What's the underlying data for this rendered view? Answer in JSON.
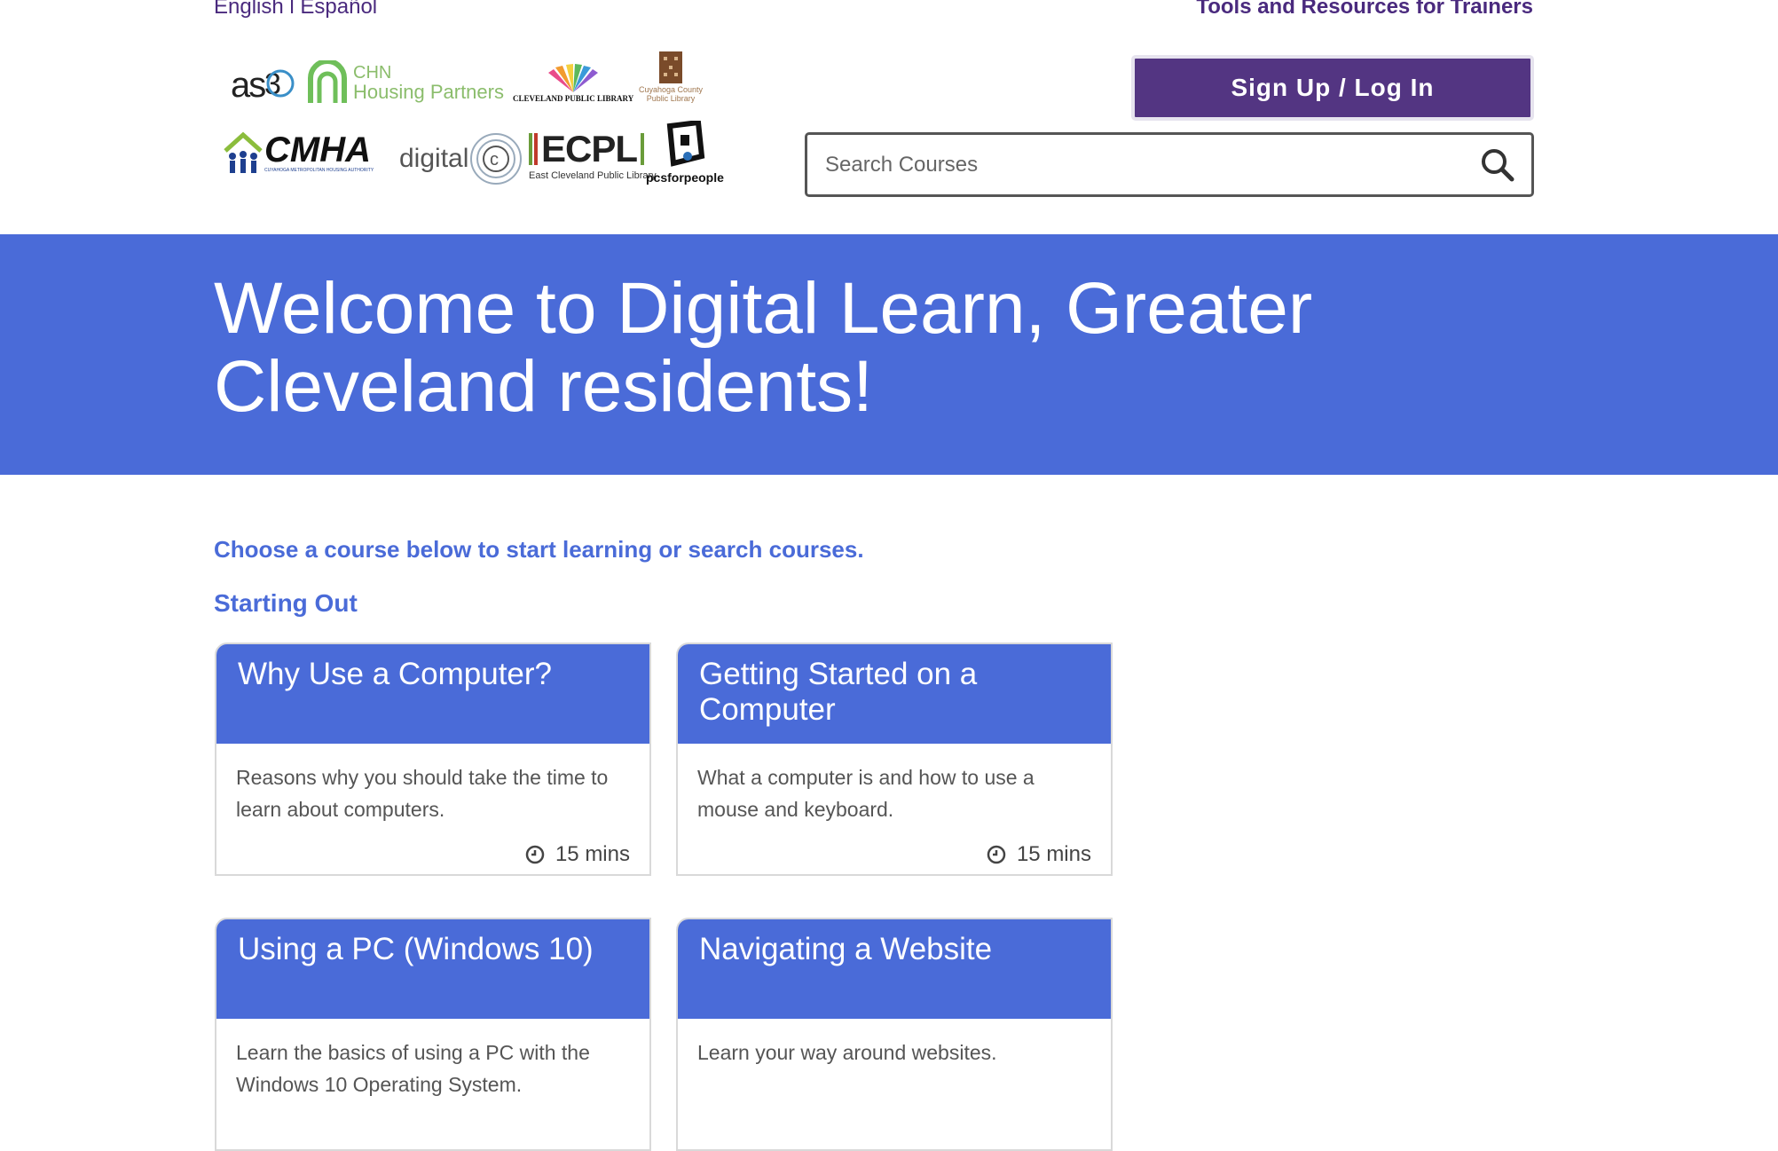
{
  "header": {
    "lang_english": "English",
    "lang_separator": " l ",
    "lang_espanol": "Español",
    "trainers_link": "Tools and Resources for Trainers",
    "signup_button": "Sign Up / Log In",
    "search_placeholder": "Search Courses"
  },
  "logos": {
    "aseb": "as",
    "chn_top": "CHN",
    "chn_bottom": "Housing Partners",
    "cleveland_public_library": "CLEVELAND PUBLIC LIBRARY",
    "cuyahoga_library_1": "Cuyahoga County",
    "cuyahoga_library_2": "Public Library",
    "cmha": "CMHA",
    "cmha_sub": "CUYAHOGA METROPOLITAN HOUSING AUTHORITY",
    "digital_c": "digital",
    "ecpl": "ECPL",
    "ecpl_sub": "East Cleveland Public Library",
    "pcs_for_people": "pcsforpeople"
  },
  "banner": {
    "title": "Welcome to Digital Learn, Greater Cleveland residents!"
  },
  "main": {
    "intro": "Choose a course below to start learning or search courses.",
    "section_title": "Starting Out",
    "courses": [
      {
        "title": "Why Use a Computer?",
        "description": "Reasons why you should take the time to learn about computers.",
        "duration": "15 mins"
      },
      {
        "title": "Getting Started on a Computer",
        "description": "What a computer is and how to use a mouse and keyboard.",
        "duration": "15 mins"
      },
      {
        "title": "Using a PC (Windows 10)",
        "description": "Learn the basics of using a PC with the Windows 10 Operating System.",
        "duration": ""
      },
      {
        "title": "Navigating a Website",
        "description": "Learn your way around websites.",
        "duration": ""
      }
    ]
  },
  "colors": {
    "banner_blue": "#4a6bd8",
    "brand_purple": "#533582",
    "link_purple": "#4a2a7e"
  }
}
